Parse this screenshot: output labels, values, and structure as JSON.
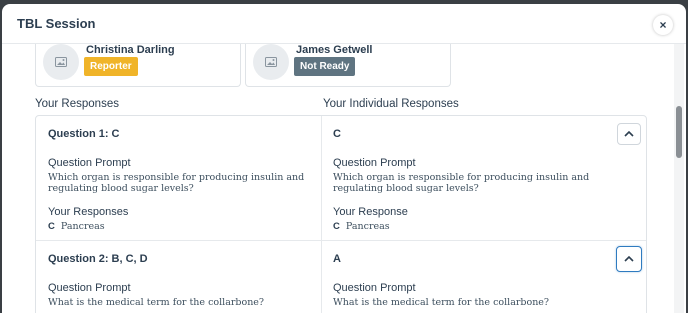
{
  "modal": {
    "title": "TBL Session",
    "close_label": "×"
  },
  "members": [
    {
      "name": "Christina Darling",
      "badge": "Reporter"
    },
    {
      "name": "James Getwell",
      "badge": "Not Ready"
    }
  ],
  "columns": {
    "left": "Your Responses",
    "right": "Your Individual Responses"
  },
  "questions": [
    {
      "title": "Question 1: C",
      "individual_answer": "C",
      "prompt_label": "Question Prompt",
      "prompt_text_1": "Which organ is responsible for producing insulin and",
      "prompt_text_2": "regulating blood sugar levels?",
      "team_responses_label": "Your Responses",
      "team_answer_letter": "C",
      "team_answer_text": "Pancreas",
      "individual_response_label": "Your Response",
      "individual_answer_letter": "C",
      "individual_answer_text": "Pancreas"
    },
    {
      "title": "Question 2: B, C, D",
      "individual_answer": "A",
      "prompt_label": "Question Prompt",
      "prompt_text_1": "What is the medical term for the collarbone?"
    }
  ]
}
